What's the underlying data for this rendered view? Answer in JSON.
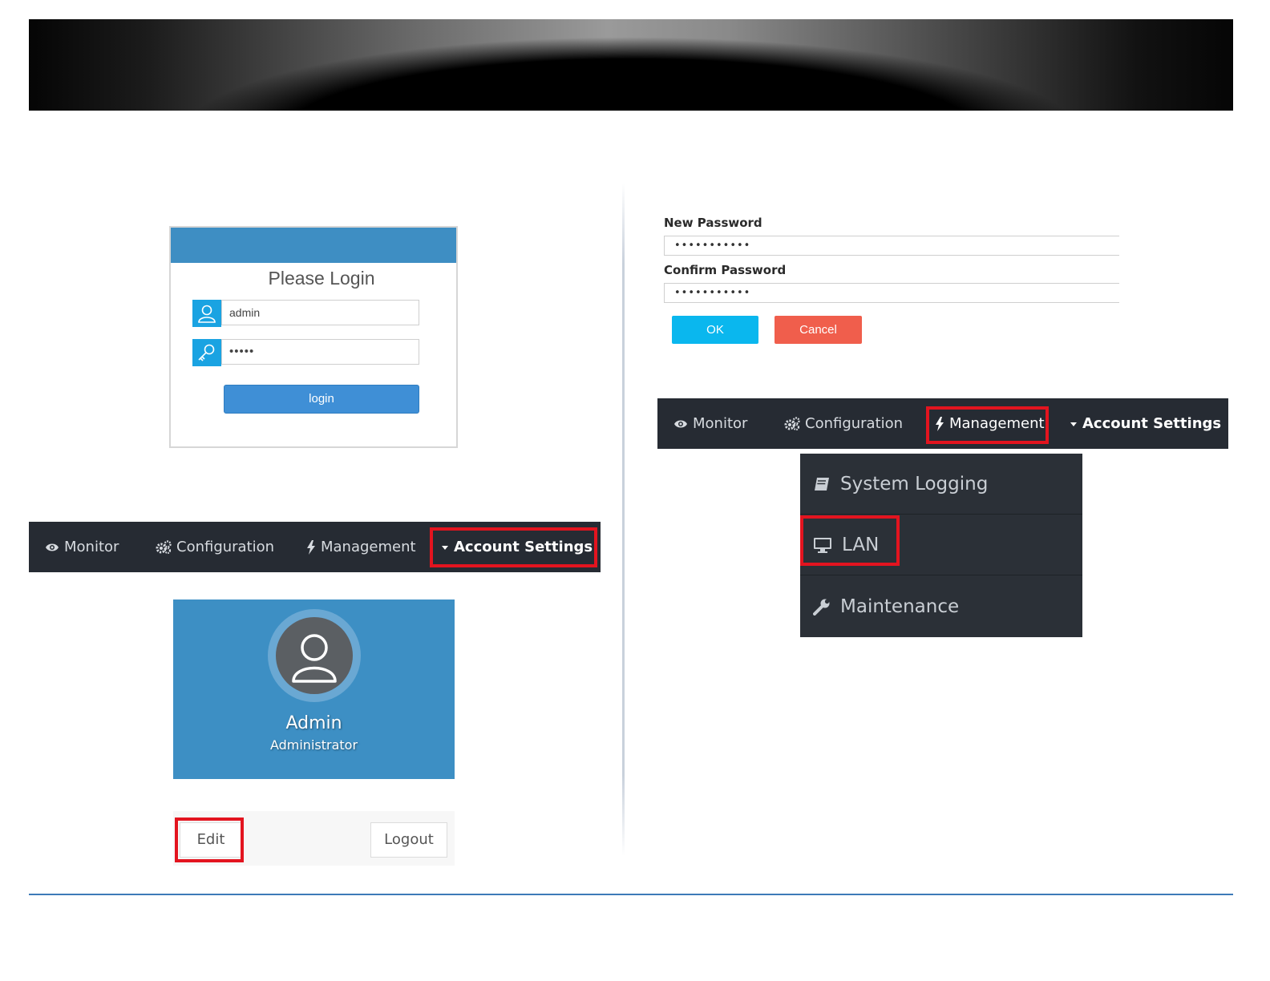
{
  "login": {
    "title": "Please Login",
    "username_value": "admin",
    "password_value": "•••••",
    "login_button": "login"
  },
  "nav_left": {
    "items": [
      {
        "label": "Monitor",
        "icon": "eye-icon"
      },
      {
        "label": "Configuration",
        "icon": "gears-icon"
      },
      {
        "label": "Management",
        "icon": "bolt-icon"
      },
      {
        "label": "Account Settings",
        "icon": "caret-down-icon"
      }
    ],
    "highlighted": "Account Settings"
  },
  "profile": {
    "name": "Admin",
    "role": "Administrator",
    "edit_button": "Edit",
    "logout_button": "Logout"
  },
  "password_form": {
    "new_label": "New Password",
    "new_value": "•••••••••••",
    "confirm_label": "Confirm Password",
    "confirm_value": "•••••••••••",
    "ok_button": "OK",
    "cancel_button": "Cancel"
  },
  "nav_right": {
    "items": [
      {
        "label": "Monitor",
        "icon": "eye-icon"
      },
      {
        "label": "Configuration",
        "icon": "gears-icon"
      },
      {
        "label": "Management",
        "icon": "bolt-icon"
      },
      {
        "label": "Account Settings",
        "icon": "caret-down-icon"
      }
    ],
    "highlighted": "Management"
  },
  "management_menu": {
    "items": [
      {
        "label": "System Logging",
        "icon": "book-icon"
      },
      {
        "label": "LAN",
        "icon": "monitor-icon"
      },
      {
        "label": "Maintenance",
        "icon": "wrench-icon"
      }
    ],
    "highlighted": "LAN"
  },
  "colors": {
    "highlight": "#e3141f",
    "nav_bg": "#262b33",
    "profile_bg": "#3d8fc4",
    "ok": "#0ab7ee",
    "cancel": "#f05e4c",
    "login_header": "#3e8ec3"
  }
}
